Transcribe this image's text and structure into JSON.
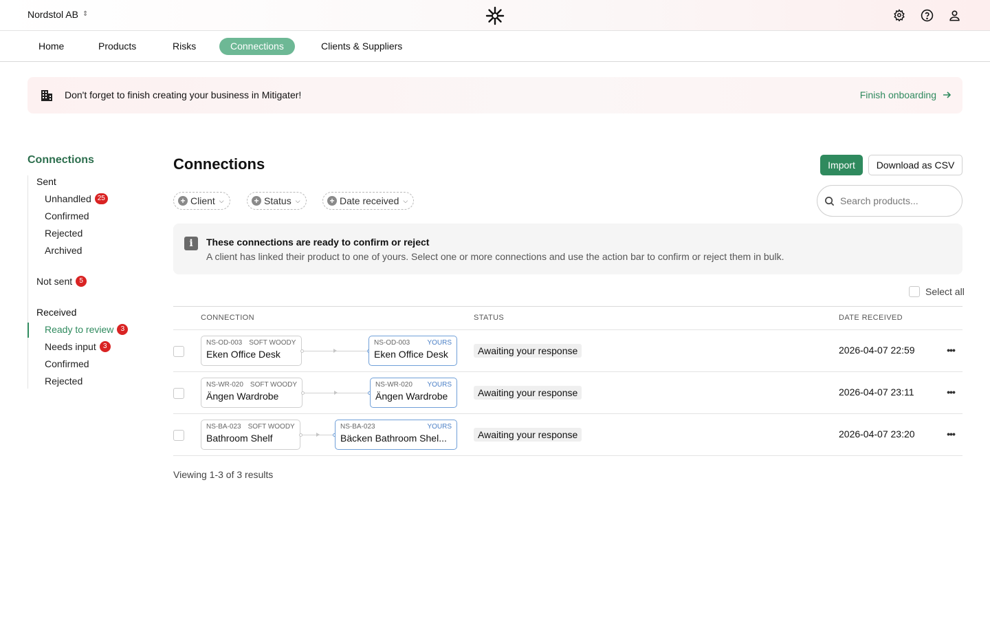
{
  "header": {
    "org_name": "Nordstol AB",
    "icons": [
      "gear-icon",
      "help-icon",
      "user-icon"
    ]
  },
  "nav": {
    "items": [
      "Home",
      "Products",
      "Risks",
      "Connections",
      "Clients & Suppliers"
    ],
    "active": "Connections"
  },
  "banner": {
    "text": "Don't forget to finish creating your business in Mitigater!",
    "link": "Finish onboarding"
  },
  "sidebar": {
    "title": "Connections",
    "sent": {
      "label": "Sent",
      "items": [
        {
          "label": "Unhandled",
          "badge": "25"
        },
        {
          "label": "Confirmed"
        },
        {
          "label": "Rejected"
        },
        {
          "label": "Archived"
        }
      ]
    },
    "not_sent": {
      "label": "Not sent",
      "badge": "5"
    },
    "received": {
      "label": "Received",
      "items": [
        {
          "label": "Ready to review",
          "badge": "3",
          "active": true
        },
        {
          "label": "Needs input",
          "badge": "3"
        },
        {
          "label": "Confirmed"
        },
        {
          "label": "Rejected"
        }
      ]
    }
  },
  "main": {
    "title": "Connections",
    "import_label": "Import",
    "csv_label": "Download as CSV",
    "filters": [
      "Client",
      "Status",
      "Date received"
    ],
    "search_placeholder": "Search products...",
    "info_title": "These connections are ready to confirm or reject",
    "info_desc": "A client has linked their product to one of yours. Select one or more connections and use the action bar to confirm or reject them in bulk.",
    "select_all": "Select all",
    "columns": [
      "CONNECTION",
      "STATUS",
      "DATE RECEIVED"
    ],
    "rows": [
      {
        "client": {
          "code": "NS-OD-003",
          "supplier": "SOFT WOODY",
          "name": "Eken Office Desk"
        },
        "own": {
          "code": "NS-OD-003",
          "tag": "YOURS",
          "name": "Eken Office Desk"
        },
        "status": "Awaiting your response",
        "date": "2026-04-07 22:59"
      },
      {
        "client": {
          "code": "NS-WR-020",
          "supplier": "SOFT WOODY",
          "name": "Ängen Wardrobe"
        },
        "own": {
          "code": "NS-WR-020",
          "tag": "YOURS",
          "name": "Ängen Wardrobe"
        },
        "status": "Awaiting your response",
        "date": "2026-04-07 23:11"
      },
      {
        "client": {
          "code": "NS-BA-023",
          "supplier": "SOFT WOODY",
          "name": "Bathroom Shelf"
        },
        "own": {
          "code": "NS-BA-023",
          "tag": "YOURS",
          "name": "Bäcken Bathroom Shel..."
        },
        "status": "Awaiting your response",
        "date": "2026-04-07 23:20"
      }
    ],
    "results_text": "Viewing 1-3 of 3 results"
  },
  "colors": {
    "brand_green": "#2f8a5e",
    "nav_active": "#6db895",
    "badge_red": "#d92323",
    "yours_blue": "#4a7fc6"
  }
}
